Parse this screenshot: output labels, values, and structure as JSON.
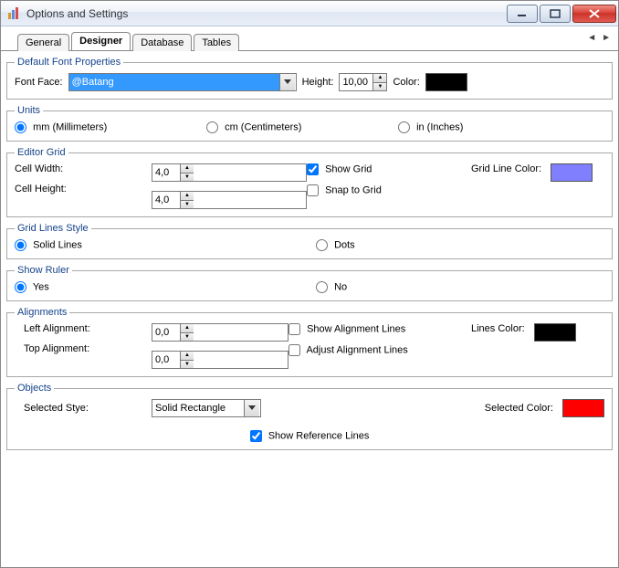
{
  "window": {
    "title": "Options and Settings"
  },
  "tabs": {
    "items": [
      {
        "label": "General"
      },
      {
        "label": "Designer"
      },
      {
        "label": "Database"
      },
      {
        "label": "Tables"
      }
    ],
    "active_index": 1
  },
  "font_props": {
    "legend": "Default Font Properties",
    "face_label": "Font Face:",
    "face_value": "@Batang",
    "height_label": "Height:",
    "height_value": "10,00",
    "color_label": "Color:",
    "color_value": "#000000"
  },
  "units": {
    "legend": "Units",
    "options": {
      "mm": "mm (Millimeters)",
      "cm": "cm (Centimeters)",
      "in": "in (Inches)"
    },
    "selected": "mm"
  },
  "editor_grid": {
    "legend": "Editor Grid",
    "cell_width_label": "Cell Width:",
    "cell_width_value": "4,0",
    "cell_height_label": "Cell Height:",
    "cell_height_value": "4,0",
    "show_grid_label": "Show Grid",
    "show_grid_checked": true,
    "snap_grid_label": "Snap to Grid",
    "snap_grid_checked": false,
    "grid_color_label": "Grid Line Color:",
    "grid_color_value": "#8080ff"
  },
  "grid_style": {
    "legend": "Grid Lines Style",
    "solid_label": "Solid Lines",
    "dots_label": "Dots",
    "selected": "solid"
  },
  "show_ruler": {
    "legend": "Show Ruler",
    "yes_label": "Yes",
    "no_label": "No",
    "selected": "yes"
  },
  "alignments": {
    "legend": "Alignments",
    "left_label": "Left Alignment:",
    "left_value": "0,0",
    "top_label": "Top Alignment:",
    "top_value": "0,0",
    "show_lines_label": "Show Alignment Lines",
    "show_lines_checked": false,
    "adjust_lines_label": "Adjust Alignment Lines",
    "adjust_lines_checked": false,
    "lines_color_label": "Lines Color:",
    "lines_color_value": "#000000"
  },
  "objects": {
    "legend": "Objects",
    "style_label": "Selected Stye:",
    "style_value": "Solid Rectangle",
    "color_label": "Selected Color:",
    "color_value": "#ff0000",
    "ref_lines_label": "Show Reference Lines",
    "ref_lines_checked": true
  }
}
